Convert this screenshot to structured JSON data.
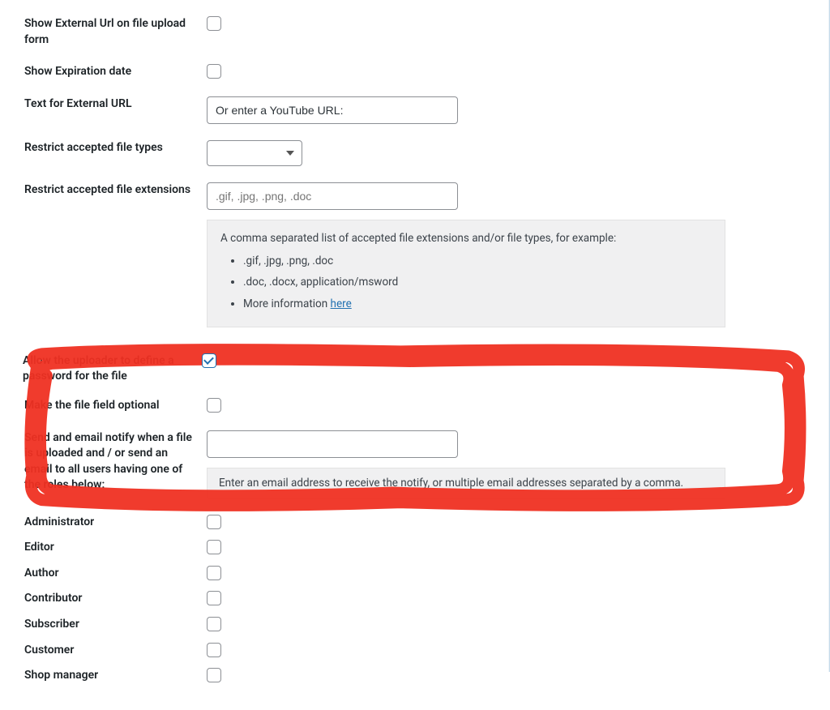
{
  "rows": {
    "show_external_url": {
      "label": "Show External Url on file upload form",
      "checked": false
    },
    "show_expiration": {
      "label": "Show Expiration date",
      "checked": false
    },
    "text_external_url": {
      "label": "Text for External URL",
      "value": "Or enter a YouTube URL:"
    },
    "restrict_types": {
      "label": "Restrict accepted file types",
      "value": ""
    },
    "restrict_ext": {
      "label": "Restrict accepted file extensions",
      "placeholder": ".gif, .jpg, .png, .doc",
      "hint_lead": "A comma separated list of accepted file extensions and/or file types, for example:",
      "hint_item1": ".gif, .jpg, .png, .doc",
      "hint_item2": ".doc, .docx, application/msword",
      "hint_item3_pre": "More information ",
      "hint_item3_link": "here"
    },
    "allow_password": {
      "label": "Allow the uploader to define a password for the file",
      "checked": true
    },
    "file_optional": {
      "label": "Make the file field optional",
      "checked": false
    },
    "email_notify": {
      "label": "Send and email notify when a file is uploaded and / or send an email to all users having one of the roles below:",
      "value": "",
      "hint": "Enter an email address to receive the notify, or multiple email addresses separated by a comma."
    }
  },
  "roles": [
    {
      "label": "Administrator",
      "checked": false
    },
    {
      "label": "Editor",
      "checked": false
    },
    {
      "label": "Author",
      "checked": false
    },
    {
      "label": "Contributor",
      "checked": false
    },
    {
      "label": "Subscriber",
      "checked": false
    },
    {
      "label": "Customer",
      "checked": false
    },
    {
      "label": "Shop manager",
      "checked": false
    }
  ],
  "colors": {
    "highlight": "#ef3022",
    "link": "#2271b1"
  }
}
